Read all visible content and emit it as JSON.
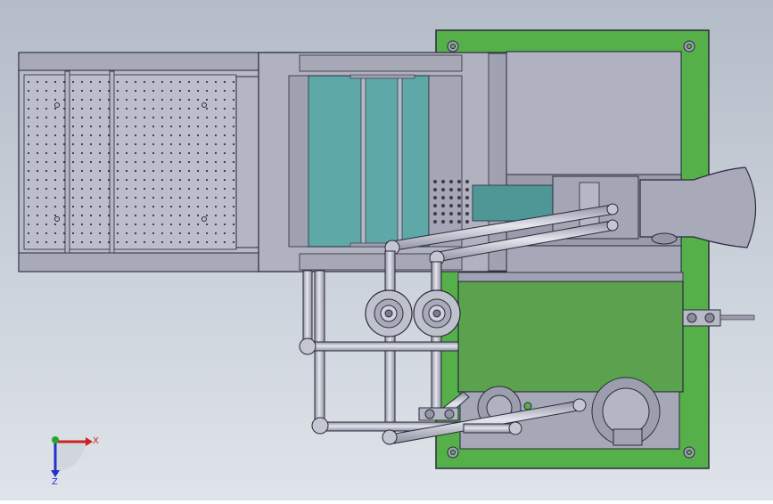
{
  "viewport": {
    "background_top": "#b4bcc8",
    "background_bottom": "#dfe4ea"
  },
  "triad": {
    "x_label": "X",
    "z_label": "Z",
    "x_color": "#cc2222",
    "y_color": "#22aa22",
    "z_color": "#2233cc"
  },
  "colors": {
    "base_plate": "#55b04a",
    "body_gray": "#a6a8b8",
    "body_light": "#b8bac8",
    "tank_green": "#5aa24e",
    "glass": "#5fa8a8",
    "outline": "#2a2a3a",
    "pipe": "#c4c6d2"
  }
}
